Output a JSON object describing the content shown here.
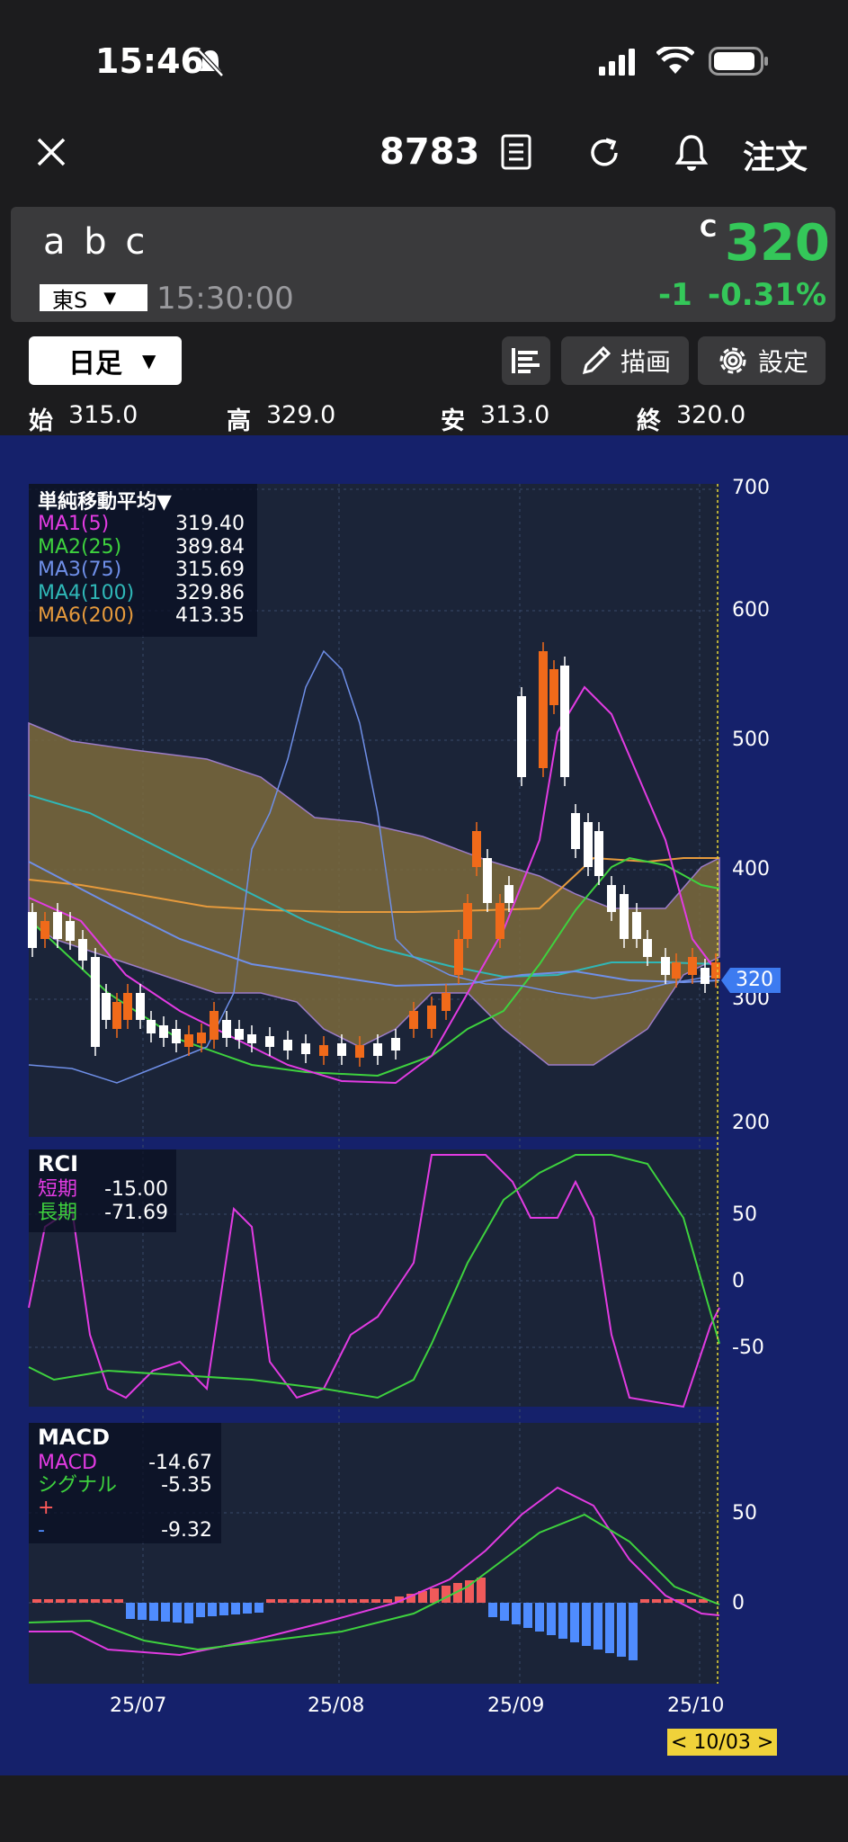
{
  "status": {
    "time": "15:46"
  },
  "nav": {
    "code": "8783",
    "order_label": "注文"
  },
  "quote": {
    "name": "a b c",
    "market": "東S",
    "time": "15:30:00",
    "price_prefix": "C",
    "price": "320",
    "change": "-1",
    "change_pct": "-0.31%",
    "price_color": "#34c759"
  },
  "toolbar": {
    "period": "日足",
    "draw_label": "描画",
    "settings_label": "設定"
  },
  "ohlc": {
    "open_label": "始",
    "open": "315.0",
    "high_label": "高",
    "high": "329.0",
    "low_label": "安",
    "low": "313.0",
    "close_label": "終",
    "close": "320.0"
  },
  "main_chart": {
    "legend_title": "単純移動平均▼",
    "ma": [
      {
        "name": "MA1(5)",
        "value": "319.40",
        "color": "#e23be2"
      },
      {
        "name": "MA2(25)",
        "value": "389.84",
        "color": "#3ed23e"
      },
      {
        "name": "MA3(75)",
        "value": "315.69",
        "color": "#6f8fe8"
      },
      {
        "name": "MA4(100)",
        "value": "329.86",
        "color": "#2fb7b7"
      },
      {
        "name": "MA6(200)",
        "value": "413.35",
        "color": "#e69a3c"
      }
    ],
    "y_ticks": [
      "700",
      "600",
      "500",
      "400",
      "300",
      "200"
    ],
    "price_tag": "320"
  },
  "rci": {
    "title": "RCI",
    "short_label": "短期",
    "short_value": "-15.00",
    "long_label": "長期",
    "long_value": "-71.69",
    "y_ticks": [
      "50",
      "0",
      "-50"
    ]
  },
  "macd": {
    "title": "MACD",
    "macd_label": "MACD",
    "macd_value": "-14.67",
    "signal_label": "シグナル",
    "signal_value": "-5.35",
    "plus_label": "+",
    "plus_value": "",
    "minus_label": "-",
    "minus_value": "-9.32",
    "y_ticks": [
      "50",
      "0"
    ]
  },
  "x_axis": {
    "labels": [
      "25/07",
      "25/08",
      "25/09",
      "25/10"
    ],
    "cursor_date": "< 10/03 >"
  }
}
